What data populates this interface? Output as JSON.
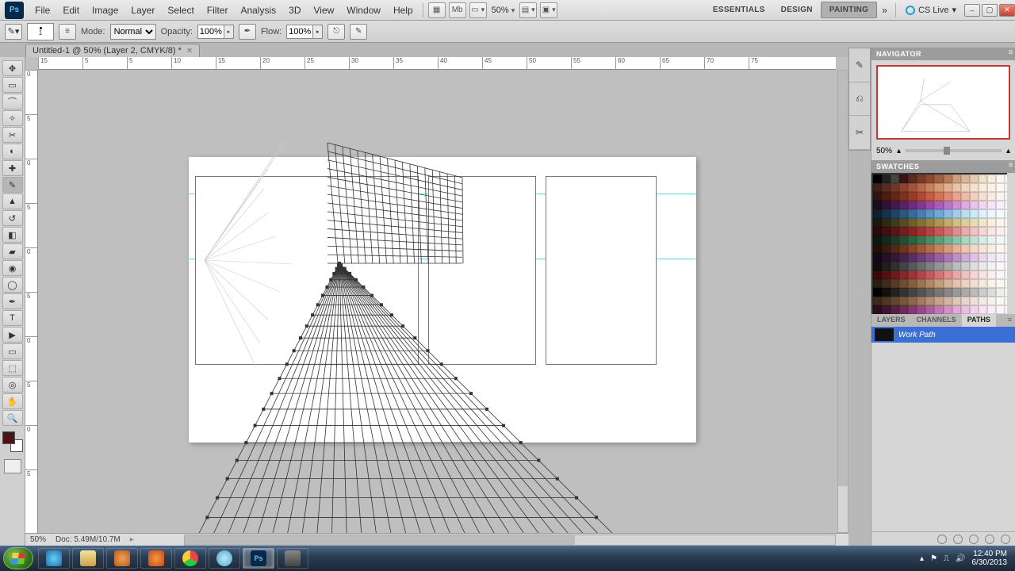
{
  "app": {
    "logo": "Ps"
  },
  "menu": [
    "File",
    "Edit",
    "Image",
    "Layer",
    "Select",
    "Filter",
    "Analysis",
    "3D",
    "View",
    "Window",
    "Help"
  ],
  "menubar": {
    "zoom": "50%"
  },
  "workspaces": {
    "essentials": "ESSENTIALS",
    "design": "DESIGN",
    "painting": "PAINTING"
  },
  "cslive": "CS Live",
  "options": {
    "brush_size": "1",
    "mode_label": "Mode:",
    "mode_value": "Normal",
    "opacity_label": "Opacity:",
    "opacity_value": "100%",
    "flow_label": "Flow:",
    "flow_value": "100%"
  },
  "document": {
    "tab_title": "Untitled-1 @ 50% (Layer 2, CMYK/8) *"
  },
  "status": {
    "zoom": "50%",
    "doc": "Doc: 5.49M/10.7M"
  },
  "ruler_h": [
    "15",
    "5",
    "5",
    "10",
    "15",
    "20",
    "25",
    "30",
    "35",
    "40",
    "45",
    "50",
    "55",
    "60",
    "65",
    "70",
    "75"
  ],
  "ruler_v": [
    "0",
    "5",
    "0",
    "5",
    "0",
    "5",
    "0",
    "5",
    "0",
    "5"
  ],
  "panels": {
    "navigator": "NAVIGATOR",
    "nav_zoom": "50%",
    "swatches": "SWATCHES",
    "layers_tabs": {
      "layers": "LAYERS",
      "channels": "CHANNELS",
      "paths": "PATHS"
    },
    "path_name": "Work Path"
  },
  "swatch_colors": [
    "#000",
    "#222",
    "#444",
    "#3a1414",
    "#5c2a1e",
    "#7a3a28",
    "#8a4a30",
    "#a06044",
    "#b87a5a",
    "#caa084",
    "#d8b89a",
    "#e6ccb2",
    "#efe0cc",
    "#f6ece0",
    "#fff6ee",
    "#fff",
    "#402018",
    "#5a2c20",
    "#703828",
    "#8a4430",
    "#a2543a",
    "#b86848",
    "#c88060",
    "#d69978",
    "#e0b090",
    "#e8c4a8",
    "#edd6c0",
    "#f2e2d2",
    "#f6ece0",
    "#faf2ea",
    "#fdf8f3",
    "#fff",
    "#30140e",
    "#4a1c12",
    "#642618",
    "#7e3020",
    "#983c28",
    "#b04a32",
    "#c45c42",
    "#d47258",
    "#e08a72",
    "#e8a48e",
    "#eebaa8",
    "#f2cec0",
    "#f6ded4",
    "#f9eae2",
    "#fcf3ee",
    "#fff",
    "#1c0c22",
    "#301238",
    "#421a4e",
    "#582266",
    "#6e2c7e",
    "#843896",
    "#9848aa",
    "#aa5cba",
    "#bc74c8",
    "#cc90d6",
    "#daace2",
    "#e6c4ec",
    "#eed8f2",
    "#f4e6f7",
    "#f9f0fb",
    "#fff",
    "#102030",
    "#18324a",
    "#224464",
    "#2c587e",
    "#386c98",
    "#4680b0",
    "#5894c4",
    "#70a8d4",
    "#8abce0",
    "#a4cee8",
    "#bcdeee",
    "#d0e8f4",
    "#e0f0f8",
    "#ecf6fb",
    "#f5fbfd",
    "#fff",
    "#1a1a0a",
    "#2e2a10",
    "#423a16",
    "#584c1e",
    "#6e5e28",
    "#847232",
    "#988440",
    "#ac9852",
    "#c0ac68",
    "#d0be82",
    "#dece9c",
    "#e8dcb6",
    "#f0e6cc",
    "#f6eede",
    "#faf5ec",
    "#fff",
    "#2a0a0a",
    "#401010",
    "#581616",
    "#701e1e",
    "#882626",
    "#a03232",
    "#b44242",
    "#c65858",
    "#d47272",
    "#e09090",
    "#e8acac",
    "#efc4c4",
    "#f4d8d8",
    "#f8e6e6",
    "#fbf0f0",
    "#fff",
    "#0a1a12",
    "#102a1c",
    "#183c28",
    "#205034",
    "#2a6442",
    "#367852",
    "#468c64",
    "#5aa07a",
    "#72b492",
    "#8cc6aa",
    "#a8d6c0",
    "#c0e2d4",
    "#d6ece4",
    "#e6f4ee",
    "#f2f9f5",
    "#fff",
    "#201008",
    "#381c0e",
    "#502816",
    "#6a3620",
    "#84462c",
    "#9e583a",
    "#b46c4c",
    "#c88262",
    "#d89a7e",
    "#e4b29a",
    "#ecc6b4",
    "#f2d8ca",
    "#f6e4da",
    "#f9eee6",
    "#fcf5f0",
    "#fff",
    "#140a18",
    "#241028",
    "#34183a",
    "#46224e",
    "#5a2e64",
    "#6e3c7a",
    "#824c90",
    "#9660a4",
    "#aa78b6",
    "#bc92c6",
    "#ceacd6",
    "#dcc4e2",
    "#e8d8ec",
    "#f0e6f4",
    "#f7f0f9",
    "#fff",
    "#0e0e0e",
    "#1e1e1e",
    "#303030",
    "#444",
    "#585858",
    "#6c6c6c",
    "#808080",
    "#949494",
    "#a8a8a8",
    "#bcbcbc",
    "#cecece",
    "#dedede",
    "#eaeaea",
    "#f2f2f2",
    "#f9f9f9",
    "#fff",
    "#3a0a0a",
    "#521212",
    "#6c1c1c",
    "#842828",
    "#9c3636",
    "#b24646",
    "#c45a5a",
    "#d47272",
    "#e08e8e",
    "#e8a8a8",
    "#efc0c0",
    "#f4d4d4",
    "#f8e2e2",
    "#fbeeee",
    "#fdf6f6",
    "#fff",
    "#2a1e12",
    "#3e2c1a",
    "#543c24",
    "#6c4e30",
    "#84603e",
    "#9c744e",
    "#b28862",
    "#c49e7a",
    "#d4b294",
    "#e0c4ae",
    "#e8d4c4",
    "#efe0d6",
    "#f4eae2",
    "#f8f1ec",
    "#fbf7f3",
    "#fff",
    "#000",
    "#111",
    "#222",
    "#333",
    "#444",
    "#555",
    "#666",
    "#777",
    "#888",
    "#999",
    "#aaa",
    "#bbb",
    "#ccc",
    "#ddd",
    "#eee",
    "#fff",
    "#3a2a1a",
    "#4e3824",
    "#624630",
    "#78563e",
    "#8e684e",
    "#a27a60",
    "#b48e76",
    "#c4a28e",
    "#d2b4a4",
    "#dec6ba",
    "#e6d4cc",
    "#eee0da",
    "#f3eae4",
    "#f7f1ed",
    "#fbf7f4",
    "#fff",
    "#2a0e1e",
    "#3e1630",
    "#542044",
    "#6c2c5a",
    "#843a72",
    "#9a4a8a",
    "#ae5ea0",
    "#c076b4",
    "#d090c6",
    "#dcaad4",
    "#e6c0e0",
    "#eed4ea",
    "#f4e2f2",
    "#f8ecf7",
    "#fbf4fb",
    "#fff"
  ],
  "taskbar": {
    "time": "12:40 PM",
    "date": "6/30/2013"
  }
}
